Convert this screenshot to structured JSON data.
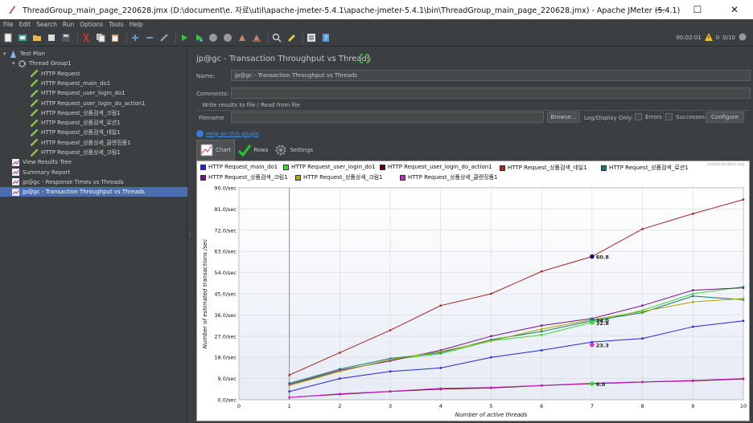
{
  "window": {
    "title": "ThreadGroup_main_page_220628.jmx (D:\\document\\e. 자료\\util\\apache-jmeter-5.4.1\\apache-jmeter-5.4.1\\bin\\ThreadGroup_main_page_220628.jmx) - Apache JMeter (5.4.1)",
    "minimize": "—",
    "maximize": "☐",
    "close": "✕"
  },
  "menu": [
    "File",
    "Edit",
    "Search",
    "Run",
    "Options",
    "Tools",
    "Help"
  ],
  "status": {
    "elapsed": "00:02:01",
    "warnings": "0",
    "threads": "0/10"
  },
  "tree": [
    {
      "label": "Test Plan",
      "indent": 0,
      "icon": "test-plan-icon",
      "toggle": "▾"
    },
    {
      "label": "Thread Group1",
      "indent": 1,
      "icon": "thread-group-icon",
      "toggle": "▾"
    },
    {
      "label": "HTTP Request",
      "indent": 2,
      "icon": "sampler-icon"
    },
    {
      "label": "HTTP Request_main_do1",
      "indent": 2,
      "icon": "sampler-icon"
    },
    {
      "label": "HTTP Request_user_login_do1",
      "indent": 2,
      "icon": "sampler-icon"
    },
    {
      "label": "HTTP Request_user_login_do_action1",
      "indent": 2,
      "icon": "sampler-icon"
    },
    {
      "label": "HTTP Request_상품검색_크림1",
      "indent": 2,
      "icon": "sampler-icon"
    },
    {
      "label": "HTTP Request_상품검색_로션1",
      "indent": 2,
      "icon": "sampler-icon"
    },
    {
      "label": "HTTP Request_상품검색_네일1",
      "indent": 2,
      "icon": "sampler-icon"
    },
    {
      "label": "HTTP Request_상품상세_클렌징폼1",
      "indent": 2,
      "icon": "sampler-icon"
    },
    {
      "label": "HTTP Request_상품상세_크림1",
      "indent": 2,
      "icon": "sampler-icon"
    },
    {
      "label": "View Results Tree",
      "indent": 1,
      "icon": "listener-icon"
    },
    {
      "label": "Summary Report",
      "indent": 1,
      "icon": "listener-icon"
    },
    {
      "label": "jp@gc - Response Times vs Threads",
      "indent": 1,
      "icon": "listener-icon"
    },
    {
      "label": "jp@gc - Transaction Throughput vs Threads",
      "indent": 1,
      "icon": "listener-icon",
      "selected": true
    }
  ],
  "panel": {
    "title": "jp@gc - Transaction Throughput vs Threads",
    "name_label": "Name:",
    "name_value": "jp@gc - Transaction Throughput vs Threads",
    "comments_label": "Comments:",
    "comments_value": "",
    "write_results_label": "Write results to file / Read from file",
    "filename_label": "Filename",
    "filename_value": "",
    "browse_label": "Browse...",
    "log_display_label": "Log/Display Only:",
    "errors_label": "Errors",
    "successes_label": "Successes",
    "configure_label": "Configure",
    "help_link": "Help on this plugin",
    "tabs": [
      "Chart",
      "Rows",
      "Settings"
    ],
    "watermark": "jmeter-plugins.org"
  },
  "chart_data": {
    "type": "line",
    "xlabel": "Number of active threads",
    "ylabel": "Number of estimated transactions /sec",
    "xlim": [
      0,
      10
    ],
    "ylim": [
      0,
      90
    ],
    "x_ticks": [
      "0",
      "1",
      "2",
      "3",
      "4",
      "5",
      "6",
      "7",
      "8",
      "9",
      "10"
    ],
    "y_ticks": [
      "0.0/sec",
      "9.0/sec",
      "18.0/sec",
      "27.0/sec",
      "36.0/sec",
      "45.0/sec",
      "54.0/sec",
      "63.0/sec",
      "72.0/sec",
      "81.0/sec",
      "90.0/sec"
    ],
    "grid": true,
    "legend_position": "top",
    "series": [
      {
        "name": "HTTP Request_main_do1",
        "color": "#2222ee",
        "x": [
          1,
          2,
          3,
          4,
          5,
          6,
          7,
          8,
          9,
          10
        ],
        "values": [
          3.5,
          9,
          12,
          13.5,
          18,
          21,
          24.5,
          26,
          31,
          33.5
        ]
      },
      {
        "name": "HTTP Request_user_login_do1",
        "color": "#33dd33",
        "x": [
          1,
          2,
          3,
          4,
          5,
          6,
          7,
          8,
          9,
          10
        ],
        "values": [
          6.5,
          12,
          17,
          19.5,
          25,
          27.5,
          32.8,
          38,
          45,
          48
        ]
      },
      {
        "name": "HTTP Request_user_login_do_action1",
        "color": "#660000",
        "x": [
          1,
          2,
          3,
          4,
          5,
          6,
          7,
          8,
          9,
          10
        ],
        "values": [
          1,
          2.3,
          3.5,
          4.5,
          5,
          6,
          6.8,
          7.5,
          8,
          8.8
        ]
      },
      {
        "name": "HTTP Request_상품검색_네일1",
        "color": "#aa2222",
        "x": [
          1,
          2,
          3,
          4,
          5,
          6,
          7,
          8,
          9,
          10
        ],
        "values": [
          10.5,
          20,
          29.5,
          40,
          45,
          54.5,
          60.8,
          72.5,
          79,
          85
        ]
      },
      {
        "name": "HTTP Request_상품검색_로션1",
        "color": "#117777",
        "x": [
          1,
          2,
          3,
          4,
          5,
          6,
          7,
          8,
          9,
          10
        ],
        "values": [
          7,
          13,
          17.5,
          20,
          25.5,
          29,
          33.5,
          37,
          44,
          42.5
        ]
      },
      {
        "name": "HTTP Request_상품검색_크림1",
        "color": "#771188",
        "x": [
          1,
          2,
          3,
          4,
          5,
          6,
          7,
          8,
          9,
          10
        ],
        "values": [
          6.5,
          12.5,
          16.5,
          21,
          27,
          31.5,
          34.5,
          40,
          46.5,
          47.5
        ]
      },
      {
        "name": "HTTP Request_상품상세_크림1",
        "color": "#aaaa00",
        "x": [
          1,
          2,
          3,
          4,
          5,
          6,
          7,
          8,
          9,
          10
        ],
        "values": [
          6,
          12,
          17,
          20.5,
          25,
          30,
          34,
          37.5,
          41.5,
          43
        ]
      },
      {
        "name": "HTTP Request_상품상세_클렌징폼1",
        "color": "#cc22cc",
        "x": [
          1,
          2,
          3,
          4,
          5,
          6,
          7,
          8,
          9,
          10
        ],
        "values": [
          1,
          2.5,
          3.6,
          4.8,
          5.2,
          6.1,
          7,
          7.6,
          8.2,
          9
        ]
      }
    ],
    "annotations": [
      {
        "x": 7,
        "y": 60.8,
        "text": "60.8",
        "color": "#111166"
      },
      {
        "x": 7,
        "y": 34.0,
        "text": "34.0",
        "color": "#117777"
      },
      {
        "x": 7,
        "y": 32.8,
        "text": "32.8",
        "color": "#33dd33"
      },
      {
        "x": 7,
        "y": 23.3,
        "text": "23.3",
        "color": "#ee22ee"
      },
      {
        "x": 7,
        "y": 6.8,
        "text": "6.8",
        "color": "#33dd33"
      }
    ]
  }
}
